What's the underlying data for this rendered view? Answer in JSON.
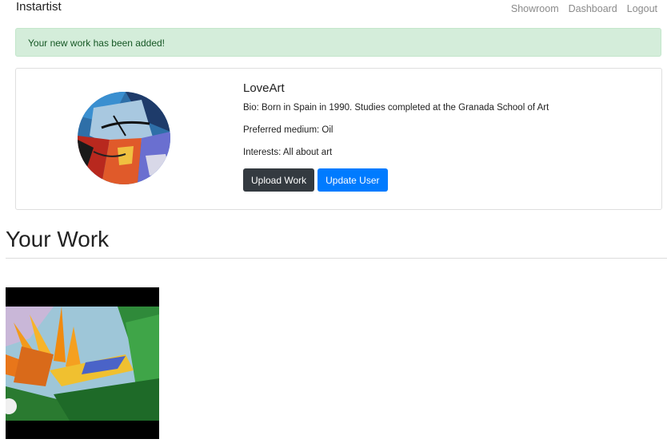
{
  "app": {
    "brand": "Instartist"
  },
  "nav": {
    "items": [
      "Showroom",
      "Dashboard",
      "Logout"
    ]
  },
  "alert": {
    "message": "Your new work has been added!"
  },
  "profile": {
    "username": "LoveArt",
    "bio": "Bio: Born in Spain in 1990. Studies completed at the Granada School of Art",
    "medium": "Preferred medium: Oil",
    "interests": "Interests: All about art",
    "buttons": {
      "upload": "Upload Work",
      "update": "Update User"
    }
  },
  "section": {
    "title": "Your Work"
  },
  "colors": {
    "alert_bg": "#d4edda",
    "alert_text": "#155724",
    "btn_dark": "#343a40",
    "btn_primary": "#007bff"
  }
}
